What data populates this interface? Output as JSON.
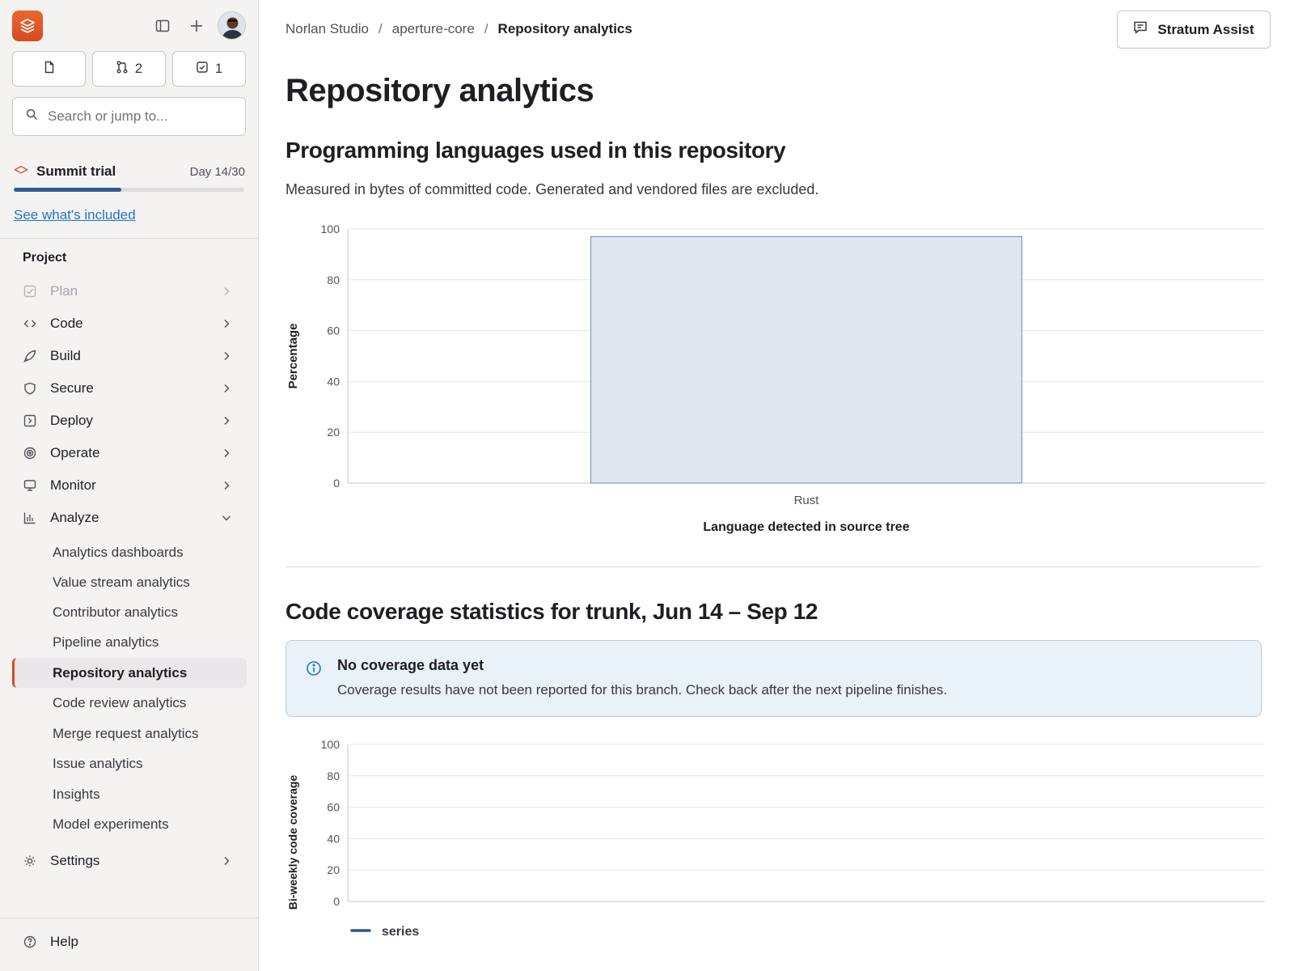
{
  "sidebar": {
    "counters": {
      "merge_requests": "2",
      "todos": "1"
    },
    "search": {
      "placeholder": "Search or jump to..."
    },
    "trial": {
      "title": "Summit trial",
      "day": "Day 14/30",
      "progress_fraction": 0.467,
      "link": "See what's included"
    },
    "section": "Project",
    "nav": [
      {
        "label": "Plan",
        "icon": "plan-icon",
        "disabled": true
      },
      {
        "label": "Code",
        "icon": "code-icon"
      },
      {
        "label": "Build",
        "icon": "rocket-icon"
      },
      {
        "label": "Secure",
        "icon": "shield-icon"
      },
      {
        "label": "Deploy",
        "icon": "deploy-icon"
      },
      {
        "label": "Operate",
        "icon": "operate-icon"
      },
      {
        "label": "Monitor",
        "icon": "monitor-icon"
      },
      {
        "label": "Analyze",
        "icon": "chart-icon",
        "expanded": true
      }
    ],
    "analyze_items": [
      "Analytics dashboards",
      "Value stream analytics",
      "Contributor analytics",
      "Pipeline analytics",
      "Repository analytics",
      "Code review analytics",
      "Merge request analytics",
      "Issue analytics",
      "Insights",
      "Model experiments"
    ],
    "active_item": "Repository analytics",
    "settings": "Settings",
    "help": "Help"
  },
  "header": {
    "breadcrumb": [
      "Norlan Studio",
      "aperture-core",
      "Repository analytics"
    ],
    "separator": "/",
    "assist_label": "Stratum Assist"
  },
  "main": {
    "title": "Repository analytics",
    "languages": {
      "heading": "Programming languages used in this repository",
      "description": "Measured in bytes of committed code. Generated and vendored files are excluded."
    },
    "coverage": {
      "heading": "Code coverage statistics for trunk, Jun 14 – Sep 12",
      "alert_title": "No coverage data yet",
      "alert_body": "Coverage results have not been reported for this branch. Check back after the next pipeline finishes."
    }
  },
  "colors": {
    "accent": "#d74a22",
    "bar_fill": "#dde4ee",
    "bar_stroke": "#7d9bc1",
    "series_line": "#2f5a8e",
    "link": "#1f75cb"
  },
  "chart_data": [
    {
      "type": "bar",
      "categories": [
        "Rust"
      ],
      "values": [
        97
      ],
      "xlabel": "Language detected in source tree",
      "ylabel": "Percentage",
      "ylim": [
        0,
        100
      ],
      "yticks": [
        0,
        20,
        40,
        60,
        80,
        100
      ],
      "grid": true
    },
    {
      "type": "line",
      "series": [
        {
          "name": "series",
          "values": []
        }
      ],
      "ylabel": "Bi-weekly code coverage",
      "ylim": [
        0,
        100
      ],
      "yticks": [
        0,
        20,
        40,
        60,
        80,
        100
      ],
      "grid": true,
      "legend": "bottom-left"
    }
  ]
}
